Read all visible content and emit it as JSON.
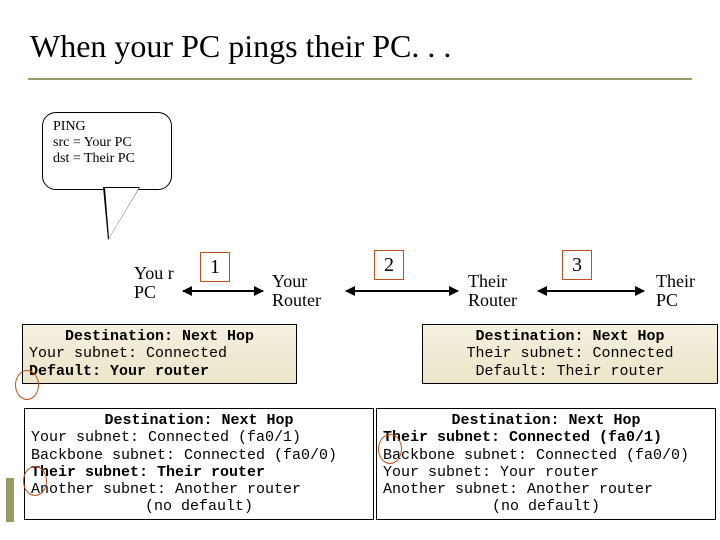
{
  "title": "When your PC pings their PC. . .",
  "callout": {
    "line1": "PING",
    "line2": "src = Your PC",
    "line3": "dst = Their PC"
  },
  "hops": {
    "h1": "1",
    "h2": "2",
    "h3": "3"
  },
  "nodes": {
    "your_pc": "You r PC",
    "your_router": "Your Router",
    "their_router": "Their Router",
    "their_pc": "Their PC"
  },
  "tables": {
    "your_pc": {
      "header": "Destination: Next Hop",
      "r1": "Your subnet: Connected",
      "r2": "Default: Your router"
    },
    "their_pc": {
      "header": "Destination: Next Hop",
      "r1": "Their subnet: Connected",
      "r2": "Default: Their router"
    },
    "your_router": {
      "header": "Destination: Next Hop",
      "r1": "Your subnet: Connected (fa0/1)",
      "r2": "Backbone subnet: Connected (fa0/0)",
      "r3": "Their subnet: Their router",
      "r4": "Another subnet: Another router",
      "r5": "(no default)"
    },
    "their_router": {
      "header": "Destination: Next Hop",
      "r1": "Their subnet: Connected (fa0/1)",
      "r2": "Backbone subnet: Connected (fa0/0)",
      "r3": "Your subnet: Your router",
      "r4": "Another subnet: Another router",
      "r5": "(no default)"
    }
  },
  "markers": {
    "m1": "1",
    "m2": "2",
    "m3": "3"
  }
}
